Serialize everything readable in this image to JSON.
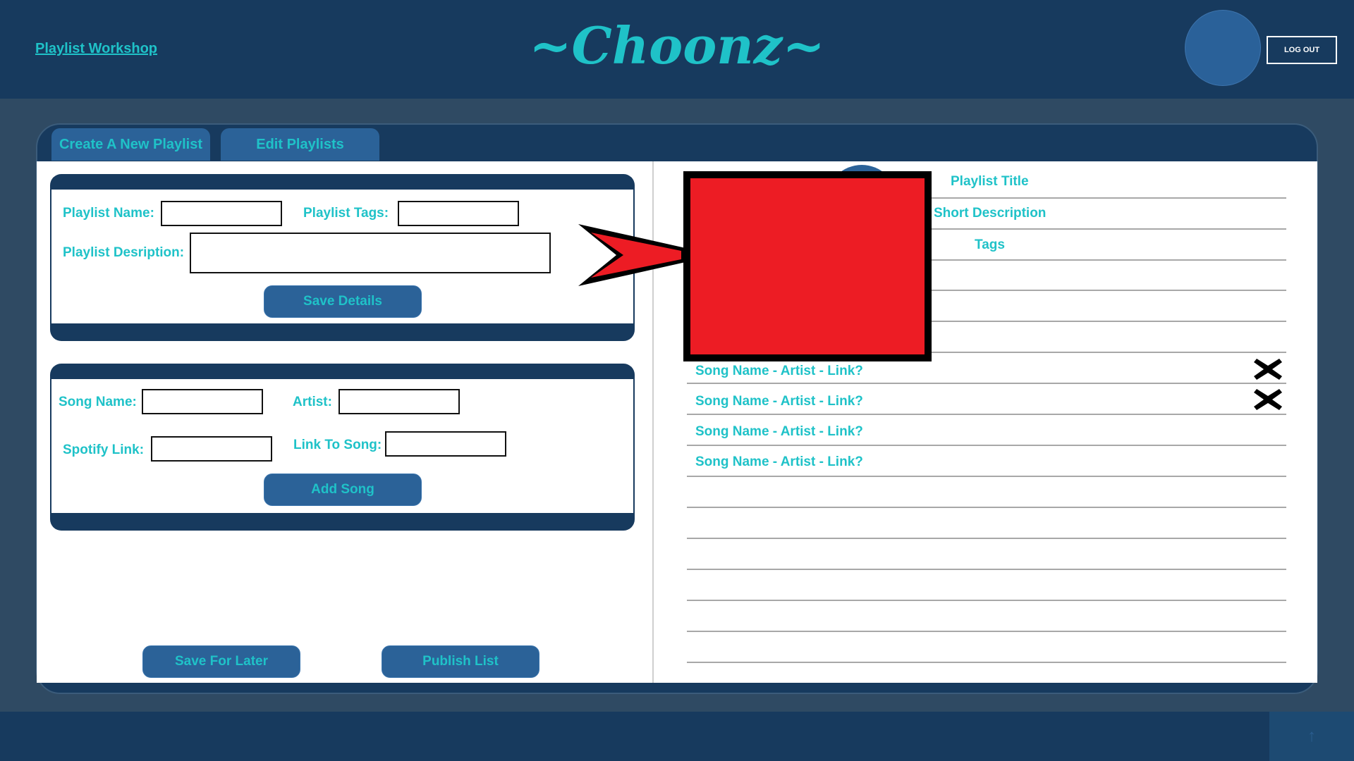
{
  "header": {
    "nav_link": "Playlist Workshop",
    "logo": "~Choonz~",
    "logout_label": "LOG OUT"
  },
  "tabs": {
    "create": "Create A New Playlist",
    "edit": "Edit Playlists"
  },
  "details_form": {
    "name_label": "Playlist Name:",
    "tags_label": "Playlist Tags:",
    "description_label": "Playlist Desription:",
    "save_label": "Save Details"
  },
  "song_form": {
    "song_label": "Song Name:",
    "artist_label": "Artist:",
    "spotify_label": "Spotify Link:",
    "link_label": "Link To Song:",
    "add_label": "Add Song"
  },
  "actions": {
    "save_later": "Save For Later",
    "publish": "Publish List"
  },
  "preview": {
    "title": "Playlist Title",
    "description": "Short Description",
    "tags": "Tags",
    "songs": [
      "Song Name - Artist - Link?",
      "Song Name - Artist - Link?",
      "Song Name - Artist - Link?",
      "Song Name - Artist - Link?"
    ]
  },
  "colors": {
    "header_bg": "#173a5e",
    "accent_text": "#1fc2c8",
    "button_bg": "#2b6298",
    "page_bg": "#2f4a63",
    "cover_red": "#ed1c24"
  },
  "icons": {
    "remove": "close-x-icon",
    "back_to_top": "arrow-up-icon"
  }
}
